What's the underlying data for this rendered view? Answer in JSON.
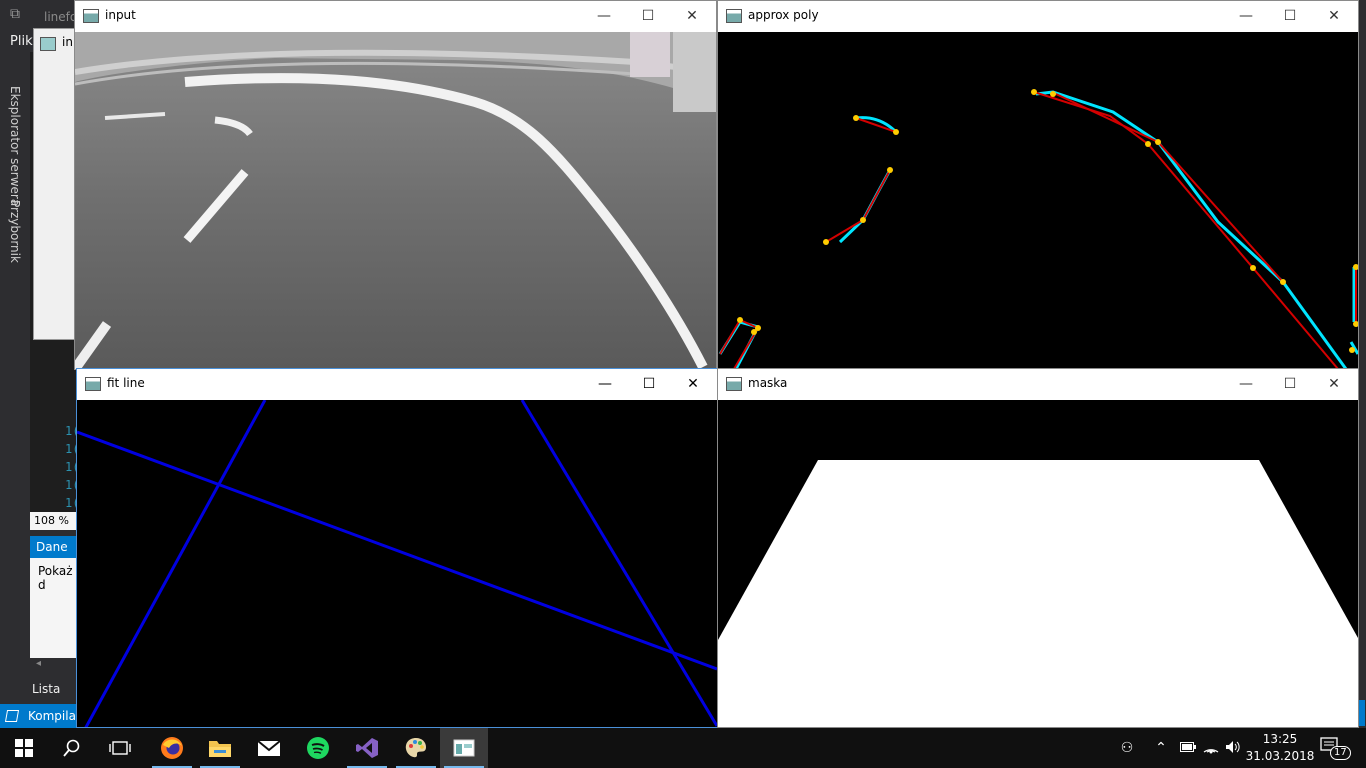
{
  "vs": {
    "menu_label": "Plik",
    "tab_partial": "linefo",
    "gray_panel_title": "in",
    "sidebar": [
      "Eksplorator serwera",
      "Przybornik"
    ],
    "line_numbers": [
      "1(",
      "1(",
      "1(",
      "1(",
      "1("
    ],
    "zoom": "108 %",
    "output_tab": "Dane w",
    "output_line": "Pokaż d",
    "error_list": "Lista błę",
    "status": "Kompilac"
  },
  "windows": {
    "input": {
      "title": "input"
    },
    "approx": {
      "title": "approx poly"
    },
    "fitline": {
      "title": "fit line"
    },
    "maska": {
      "title": "maska"
    }
  },
  "window_buttons": {
    "minimize": "—",
    "maximize": "☐",
    "close": "✕"
  },
  "colors": {
    "vs_accent": "#007acc",
    "contour": "#00e5ff",
    "poly": "#d40000",
    "vertex": "#ffcc00",
    "fit_line": "#0000e0",
    "mask": "#ffffff"
  },
  "taskbar": {
    "items": [
      {
        "name": "start",
        "icon": "windows-logo-icon"
      },
      {
        "name": "search",
        "icon": "search-icon"
      },
      {
        "name": "task-view",
        "icon": "task-view-icon"
      },
      {
        "name": "firefox",
        "icon": "firefox-icon"
      },
      {
        "name": "explorer",
        "icon": "folder-icon"
      },
      {
        "name": "mail",
        "icon": "mail-icon"
      },
      {
        "name": "spotify",
        "icon": "spotify-icon"
      },
      {
        "name": "visual-studio",
        "icon": "visual-studio-icon"
      },
      {
        "name": "paint",
        "icon": "palette-icon"
      },
      {
        "name": "opencv",
        "icon": "window-app-icon"
      }
    ],
    "time": "13:25",
    "date": "31.03.2018",
    "notification_count": "17"
  }
}
